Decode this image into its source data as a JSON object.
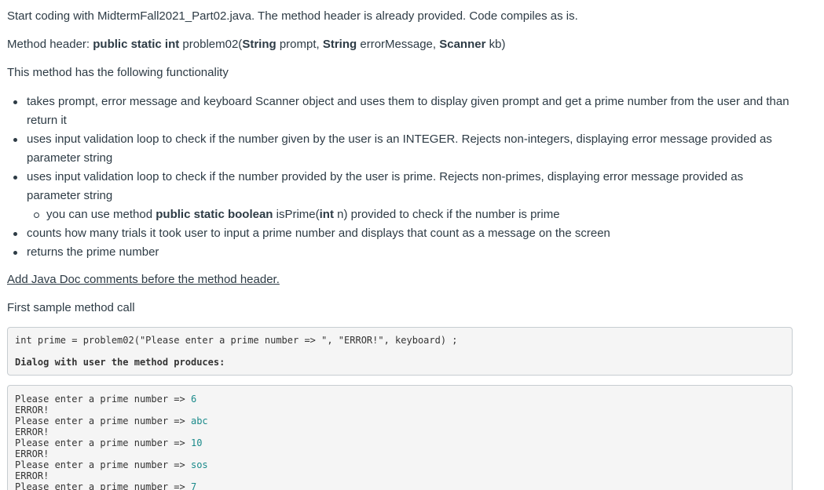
{
  "intro": {
    "line1": "Start coding with MidtermFall2021_Part02.java. The method header is already provided. Code compiles as is.",
    "header_label": "Method header: ",
    "header_kw1": "public static int",
    "header_name": " problem02(",
    "header_type1": "String",
    "header_arg1": " prompt, ",
    "header_type2": "String",
    "header_arg2": " errorMessage, ",
    "header_type3": "Scanner",
    "header_arg3": " kb)",
    "functionality": "This method has the following functionality"
  },
  "bullets": [
    "takes prompt, error message and keyboard Scanner object and uses them to display given prompt and get a prime number from the user and than return it",
    "uses input validation loop to check if the number given by the user is an INTEGER. Rejects non-integers, displaying error message provided as parameter string",
    "uses input validation loop to check if the number provided by the user is prime. Rejects non-primes, displaying error message provided as parameter string"
  ],
  "sub_bullet": {
    "pre": "you can use method ",
    "kw": "public static boolean",
    "name": " isPrime(",
    "type": "int",
    "post": " n) provided to check if the number is prime"
  },
  "bullets_after": [
    "counts how many trials it took user to input a prime number and displays that count as a message on the screen",
    "returns the prime number"
  ],
  "javadoc_note": "Add Java Doc comments before the method header.",
  "first_sample": "First sample method call",
  "code1": {
    "call": "int prime = problem02(\"Please enter a prime number => \", \"ERROR!\", keyboard) ;",
    "dialog": "Dialog with user the method produces:"
  },
  "dialog_lines": [
    {
      "prompt": "Please enter a prime number => ",
      "input": "6"
    },
    {
      "prompt": "ERROR!",
      "input": ""
    },
    {
      "prompt": "Please enter a prime number => ",
      "input": "abc"
    },
    {
      "prompt": "ERROR!",
      "input": ""
    },
    {
      "prompt": "Please enter a prime number => ",
      "input": "10"
    },
    {
      "prompt": "ERROR!",
      "input": ""
    },
    {
      "prompt": "Please enter a prime number => ",
      "input": "sos"
    },
    {
      "prompt": "ERROR!",
      "input": ""
    },
    {
      "prompt": "Please enter a prime number => ",
      "input": "7"
    }
  ]
}
